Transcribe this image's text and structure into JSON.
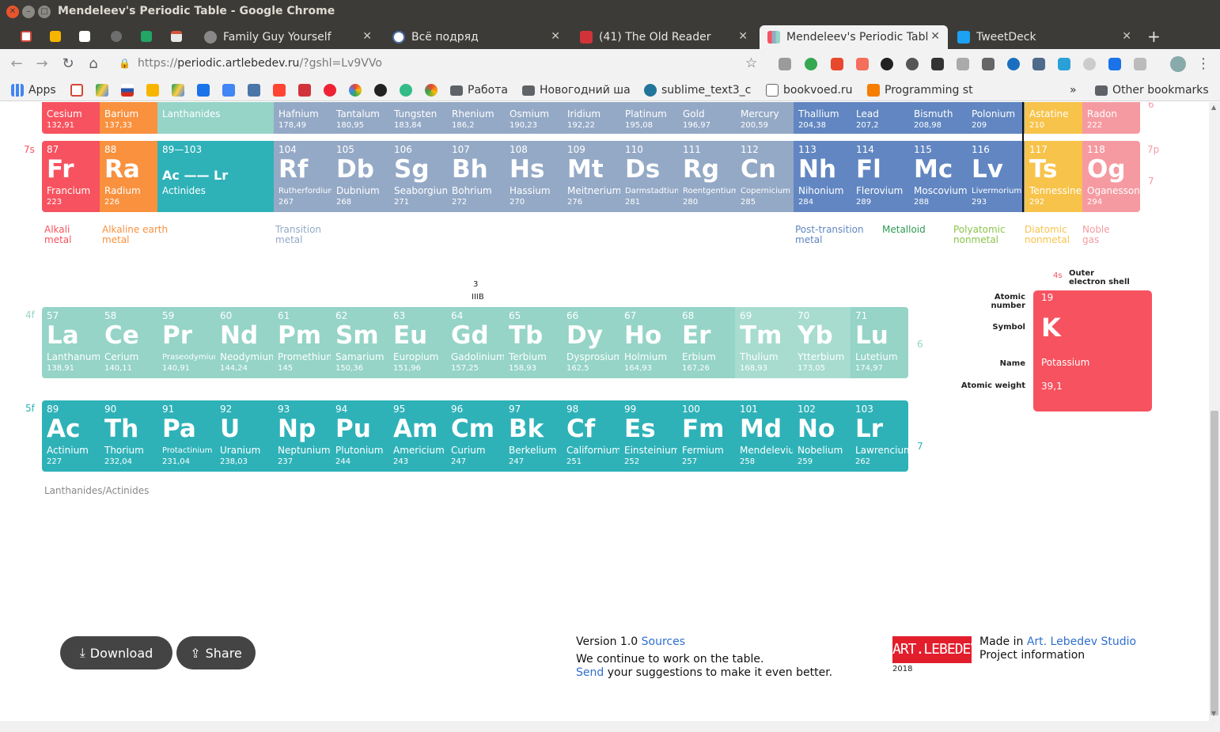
{
  "window": {
    "title": "Mendeleev's Periodic Table - Google Chrome"
  },
  "tabs": [
    {
      "label": "Family Guy Yourself",
      "color": "#888888"
    },
    {
      "label": "Всё подряд",
      "color": "#4a6fa5"
    },
    {
      "label": "(41) The Old Reader",
      "color": "#d0343a"
    },
    {
      "label": "Mendeleev's Periodic Table",
      "color": "#5b7fbf"
    },
    {
      "label": "TweetDeck",
      "color": "#1da1f2"
    }
  ],
  "address": {
    "scheme": "https://",
    "host": "periodic.artlebedev.ru",
    "path": "/?gshl=Lv9VVo"
  },
  "bookmarks": {
    "apps": "Apps",
    "rabota": "Работа",
    "novogodniy": "Новогодний ша",
    "sublime": "sublime_text3_c",
    "bookvoed": "bookvoed.ru",
    "programming": "Programming st",
    "more": "»",
    "other": "Other bookmarks"
  },
  "periods": {
    "p6b": "6",
    "p7s": "7s",
    "p7p": "7p",
    "p7r": "7",
    "p4f": "4f",
    "p6r": "6",
    "p5f": "5f",
    "p7rb": "7"
  },
  "row6": [
    {
      "name": "Cesium",
      "weight": "132,91"
    },
    {
      "name": "Barium",
      "weight": "137,33"
    },
    {
      "name": "Lanthanides",
      "weight": ""
    },
    {
      "name": "Hafnium",
      "weight": "178,49"
    },
    {
      "name": "Tantalum",
      "weight": "180,95"
    },
    {
      "name": "Tungsten",
      "weight": "183,84"
    },
    {
      "name": "Rhenium",
      "weight": "186,2"
    },
    {
      "name": "Osmium",
      "weight": "190,23"
    },
    {
      "name": "Iridium",
      "weight": "192,22"
    },
    {
      "name": "Platinum",
      "weight": "195,08"
    },
    {
      "name": "Gold",
      "weight": "196,97"
    },
    {
      "name": "Mercury",
      "weight": "200,59"
    },
    {
      "name": "Thallium",
      "weight": "204,38"
    },
    {
      "name": "Lead",
      "weight": "207,2"
    },
    {
      "name": "Bismuth",
      "weight": "208,98"
    },
    {
      "name": "Polonium",
      "weight": "209"
    },
    {
      "name": "Astatine",
      "weight": "210"
    },
    {
      "name": "Radon",
      "weight": "222"
    }
  ],
  "row7": [
    {
      "num": "87",
      "sym": "Fr",
      "name": "Francium",
      "weight": "223"
    },
    {
      "num": "88",
      "sym": "Ra",
      "name": "Radium",
      "weight": "226"
    },
    {
      "num": "89—103",
      "sym": "Ac —— Lr",
      "name": "Actinides",
      "weight": ""
    },
    {
      "num": "104",
      "sym": "Rf",
      "name": "Rutherfordium",
      "weight": "267"
    },
    {
      "num": "105",
      "sym": "Db",
      "name": "Dubnium",
      "weight": "268"
    },
    {
      "num": "106",
      "sym": "Sg",
      "name": "Seaborgium",
      "weight": "271"
    },
    {
      "num": "107",
      "sym": "Bh",
      "name": "Bohrium",
      "weight": "272"
    },
    {
      "num": "108",
      "sym": "Hs",
      "name": "Hassium",
      "weight": "270"
    },
    {
      "num": "109",
      "sym": "Mt",
      "name": "Meitnerium",
      "weight": "276"
    },
    {
      "num": "110",
      "sym": "Ds",
      "name": "Darmstadtium",
      "weight": "281"
    },
    {
      "num": "111",
      "sym": "Rg",
      "name": "Roentgentium",
      "weight": "280"
    },
    {
      "num": "112",
      "sym": "Cn",
      "name": "Copernicium",
      "weight": "285"
    },
    {
      "num": "113",
      "sym": "Nh",
      "name": "Nihonium",
      "weight": "284"
    },
    {
      "num": "114",
      "sym": "Fl",
      "name": "Flerovium",
      "weight": "289"
    },
    {
      "num": "115",
      "sym": "Mc",
      "name": "Moscovium",
      "weight": "288"
    },
    {
      "num": "116",
      "sym": "Lv",
      "name": "Livermorium",
      "weight": "293"
    },
    {
      "num": "117",
      "sym": "Ts",
      "name": "Tennessine",
      "weight": "292"
    },
    {
      "num": "118",
      "sym": "Og",
      "name": "Oganesson",
      "weight": "294"
    }
  ],
  "legend": {
    "alkali": "Alkali\nmetal",
    "alkaline": "Alkaline earth\nmetal",
    "transition": "Transition\nmetal",
    "post": "Post-transition\nmetal",
    "metalloid": "Metalloid",
    "polyatomic": "Polyatomic\nnonmetal",
    "diatomic": "Diatomic\nnonmetal",
    "noble": "Noble\ngas"
  },
  "group3": {
    "num": "3",
    "roman": "IIIB"
  },
  "lanthanides": [
    {
      "num": "57",
      "sym": "La",
      "name": "Lanthanum",
      "weight": "138,91"
    },
    {
      "num": "58",
      "sym": "Ce",
      "name": "Cerium",
      "weight": "140,11"
    },
    {
      "num": "59",
      "sym": "Pr",
      "name": "Praseodymium",
      "weight": "140,91"
    },
    {
      "num": "60",
      "sym": "Nd",
      "name": "Neodymium",
      "weight": "144,24"
    },
    {
      "num": "61",
      "sym": "Pm",
      "name": "Promethium",
      "weight": "145"
    },
    {
      "num": "62",
      "sym": "Sm",
      "name": "Samarium",
      "weight": "150,36"
    },
    {
      "num": "63",
      "sym": "Eu",
      "name": "Europium",
      "weight": "151,96"
    },
    {
      "num": "64",
      "sym": "Gd",
      "name": "Gadolinium",
      "weight": "157,25"
    },
    {
      "num": "65",
      "sym": "Tb",
      "name": "Terbium",
      "weight": "158,93"
    },
    {
      "num": "66",
      "sym": "Dy",
      "name": "Dysprosium",
      "weight": "162,5"
    },
    {
      "num": "67",
      "sym": "Ho",
      "name": "Holmium",
      "weight": "164,93"
    },
    {
      "num": "68",
      "sym": "Er",
      "name": "Erbium",
      "weight": "167,26"
    },
    {
      "num": "69",
      "sym": "Tm",
      "name": "Thulium",
      "weight": "168,93"
    },
    {
      "num": "70",
      "sym": "Yb",
      "name": "Ytterbium",
      "weight": "173,05"
    },
    {
      "num": "71",
      "sym": "Lu",
      "name": "Lutetium",
      "weight": "174,97"
    }
  ],
  "actinides": [
    {
      "num": "89",
      "sym": "Ac",
      "name": "Actinium",
      "weight": "227"
    },
    {
      "num": "90",
      "sym": "Th",
      "name": "Thorium",
      "weight": "232,04"
    },
    {
      "num": "91",
      "sym": "Pa",
      "name": "Protactinium",
      "weight": "231,04"
    },
    {
      "num": "92",
      "sym": "U",
      "name": "Uranium",
      "weight": "238,03"
    },
    {
      "num": "93",
      "sym": "Np",
      "name": "Neptunium",
      "weight": "237"
    },
    {
      "num": "94",
      "sym": "Pu",
      "name": "Plutonium",
      "weight": "244"
    },
    {
      "num": "95",
      "sym": "Am",
      "name": "Americium",
      "weight": "243"
    },
    {
      "num": "96",
      "sym": "Cm",
      "name": "Curium",
      "weight": "247"
    },
    {
      "num": "97",
      "sym": "Bk",
      "name": "Berkelium",
      "weight": "247"
    },
    {
      "num": "98",
      "sym": "Cf",
      "name": "Californium",
      "weight": "251"
    },
    {
      "num": "99",
      "sym": "Es",
      "name": "Einsteinium",
      "weight": "252"
    },
    {
      "num": "100",
      "sym": "Fm",
      "name": "Fermium",
      "weight": "257"
    },
    {
      "num": "101",
      "sym": "Md",
      "name": "Mendelevium",
      "weight": "258"
    },
    {
      "num": "102",
      "sym": "No",
      "name": "Nobelium",
      "weight": "259"
    },
    {
      "num": "103",
      "sym": "Lr",
      "name": "Lawrencium",
      "weight": "262"
    }
  ],
  "footnote": "Lanthanides/Actinides",
  "key": {
    "shell_code": "4s",
    "shell_label": "Outer\nelectron shell",
    "atomic_number_label": "Atomic\nnumber",
    "symbol_label": "Symbol",
    "name_label": "Name",
    "weight_label": "Atomic weight",
    "num": "19",
    "sym": "K",
    "name": "Potassium",
    "weight": "39,1"
  },
  "buttons": {
    "download": "Download",
    "share": "Share"
  },
  "footer": {
    "version": "Version 1.0",
    "sources": "Sources",
    "line2": "We continue to work on the table.",
    "send": "Send",
    "line3": "your suggestions to make it even better.",
    "logo": "ART.LEBEDEV",
    "year": "2018",
    "made_in": "Made in",
    "studio": "Art. Lebedev Studio",
    "project": "Project information"
  }
}
